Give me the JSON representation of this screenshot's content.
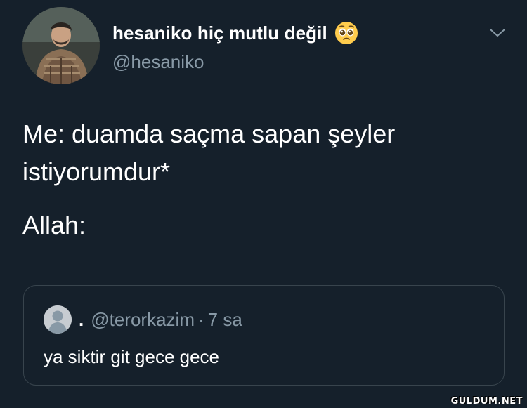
{
  "author": {
    "display_name": "hesaniko hiç mutlu değil",
    "handle": "@hesaniko",
    "name_emoji": "pleading-face-emoji"
  },
  "tweet": {
    "lines": [
      "Me: duamda saçma sapan şeyler",
      "istiyorumdur*",
      "Allah:"
    ]
  },
  "quoted_tweet": {
    "display_name": ".",
    "handle": "@terorkazim",
    "separator": "·",
    "time": "7 sa",
    "text": "ya siktir git gece gece"
  },
  "watermark": "GULDUM.NET",
  "icons": {
    "menu": "chevron-down-icon",
    "quoted_avatar": "default-avatar-icon"
  },
  "colors": {
    "background": "#15202b",
    "secondary_text": "#8899a6",
    "border": "#38444d"
  }
}
